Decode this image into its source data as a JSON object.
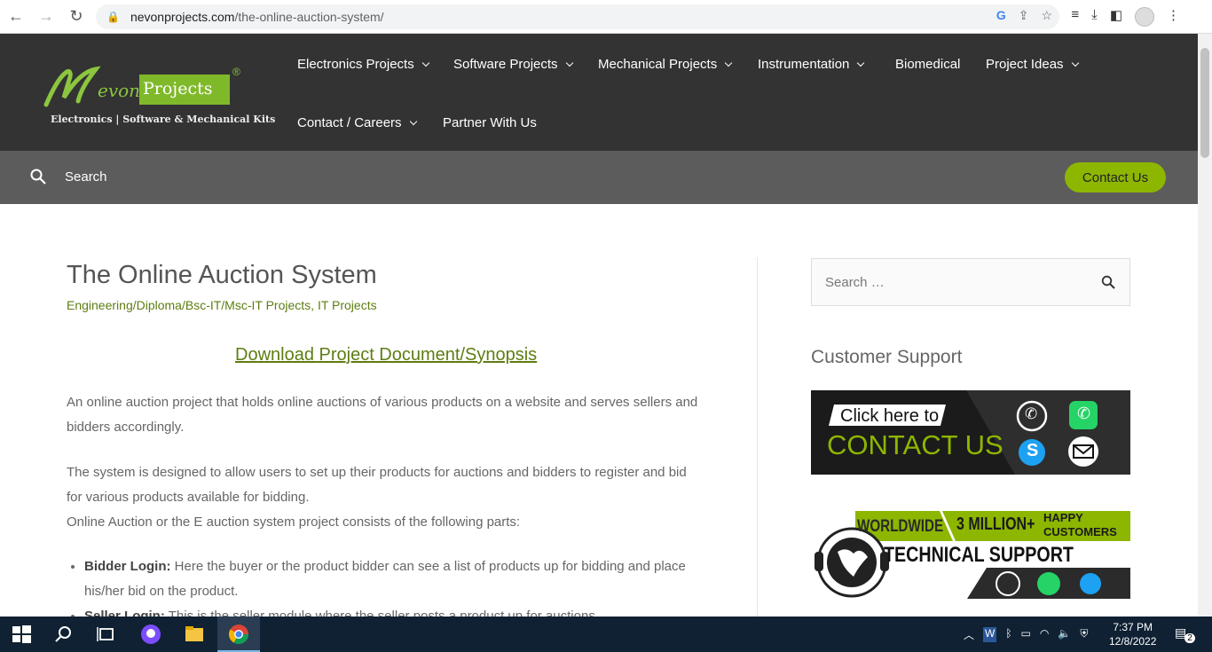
{
  "browser": {
    "url_domain": "nevonprojects.com",
    "url_path": "/the-online-auction-system/"
  },
  "header": {
    "logo": {
      "evon": "evon",
      "projects": "Projects",
      "reg": "®",
      "tagline": "Electronics | Software & Mechanical Kits"
    },
    "menu": [
      {
        "label": "Electronics Projects",
        "dropdown": true
      },
      {
        "label": "Software Projects",
        "dropdown": true
      },
      {
        "label": "Mechanical Projects",
        "dropdown": true
      },
      {
        "label": "Instrumentation",
        "dropdown": true
      },
      {
        "label": "Biomedical",
        "dropdown": false
      },
      {
        "label": "Project Ideas",
        "dropdown": true
      },
      {
        "label": "Contact / Careers",
        "dropdown": true
      },
      {
        "label": "Partner With Us",
        "dropdown": false
      }
    ]
  },
  "searchbar": {
    "label": "Search",
    "contact_button": "Contact Us"
  },
  "article": {
    "title": "The Online Auction System",
    "categories": "Engineering/Diploma/Bsc-IT/Msc-IT Projects, IT Projects",
    "download_link": "Download Project Document/Synopsis",
    "para1": "An online auction project that holds online auctions of various products on a website and serves sellers and bidders accordingly.",
    "para2": "The system is designed to allow users to set up their products for auctions and bidders to register and bid for various products available for bidding.",
    "para3": "Online Auction or the E auction system project consists of the following parts:",
    "bullets": [
      {
        "title": "Bidder Login:",
        "text": " Here the buyer or the product bidder can see a list of products up for bidding and place his/her bid on the product."
      },
      {
        "title": "Seller Login:",
        "text": " This is the seller module where the seller posts a product up for auctions."
      }
    ]
  },
  "sidebar": {
    "search_placeholder": "Search …",
    "customer_support_title": "Customer Support",
    "banner1": {
      "line1": "Click here to",
      "line2": "CONTACT US"
    },
    "banner2": {
      "worldwide": "WORLDWIDE",
      "million": "3 MILLION+",
      "happy": "HAPPY",
      "customers": "CUSTOMERS",
      "tech": "TECHNICAL SUPPORT"
    }
  },
  "taskbar": {
    "time": "7:37 PM",
    "date": "12/8/2022",
    "notifications": "2"
  },
  "colors": {
    "header_bg": "#333333",
    "accent_green": "#8db600",
    "link_green": "#5e7d12"
  }
}
